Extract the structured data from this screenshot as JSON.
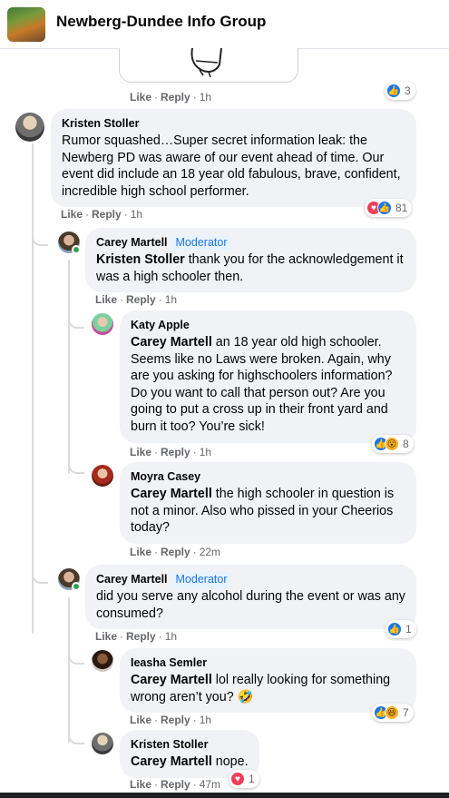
{
  "header": {
    "group_name": "Newberg-Dundee Info Group"
  },
  "colors": {
    "accent": "#1877f2",
    "love": "#f33e58",
    "bubble": "#f0f2f5",
    "meta": "#65676b"
  },
  "comments": [
    {
      "meta": {
        "like": "Like",
        "reply": "Reply",
        "time": "1h"
      },
      "reactions": {
        "icons": [
          "like-icon"
        ],
        "count": "3"
      }
    },
    {
      "author": "Kristen Stoller",
      "text": "Rumor squashed…Super secret information leak: the Newberg PD was aware of our event ahead of time. Our event did include an 18 year old fabulous, brave, confident, incredible high school performer.",
      "meta": {
        "like": "Like",
        "reply": "Reply",
        "time": "1h"
      },
      "reactions": {
        "icons": [
          "love-icon",
          "like-icon"
        ],
        "count": "81"
      }
    },
    {
      "author": "Carey Martell",
      "badge": "Moderator",
      "mention": "Kristen Stoller",
      "text": "thank you for the acknowledgement it was a high schooler then.",
      "meta": {
        "like": "Like",
        "reply": "Reply",
        "time": "1h"
      }
    },
    {
      "author": "Katy Apple",
      "mention": "Carey Martell",
      "text": "an 18 year old high schooler. Seems like no Laws were broken. Again, why are you asking for highschoolers information? Do you want to call that person out? Are you going to put a cross up in their front yard and burn it too? You’re sick!",
      "meta": {
        "like": "Like",
        "reply": "Reply",
        "time": "1h"
      },
      "reactions": {
        "icons": [
          "like-icon",
          "wow-icon"
        ],
        "count": "8"
      }
    },
    {
      "author": "Moyra Casey",
      "mention": "Carey Martell",
      "text": "the high schooler in question is not a minor. Also who pissed in your Cheerios today?",
      "meta": {
        "like": "Like",
        "reply": "Reply",
        "time": "22m"
      }
    },
    {
      "author": "Carey Martell",
      "badge": "Moderator",
      "text": "did you serve any alcohol during the event or was any consumed?",
      "meta": {
        "like": "Like",
        "reply": "Reply",
        "time": "1h"
      },
      "reactions": {
        "icons": [
          "like-icon"
        ],
        "count": "1"
      }
    },
    {
      "author": "Ieasha Semler",
      "mention": "Carey Martell",
      "text": "lol really looking for something wrong aren’t you? 🤣",
      "meta": {
        "like": "Like",
        "reply": "Reply",
        "time": "1h"
      },
      "reactions": {
        "icons": [
          "like-icon",
          "haha-icon"
        ],
        "count": "7"
      }
    },
    {
      "author": "Kristen Stoller",
      "mention": "Carey Martell",
      "text": "nope.",
      "meta": {
        "like": "Like",
        "reply": "Reply",
        "time": "47m"
      },
      "reactions": {
        "icons": [
          "love-icon"
        ],
        "count": "1"
      }
    }
  ]
}
